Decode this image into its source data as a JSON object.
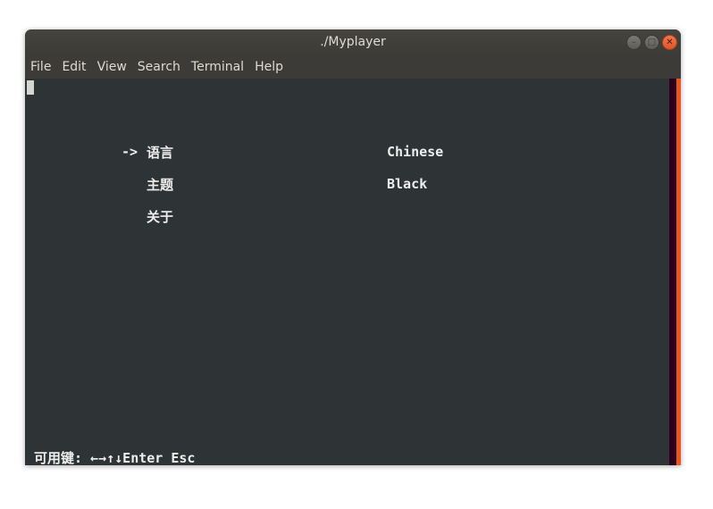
{
  "window": {
    "title": "./Myplayer",
    "controls": {
      "minimize": "–",
      "maximize": "□",
      "close": "✕"
    }
  },
  "menubar": {
    "items": [
      "File",
      "Edit",
      "View",
      "Search",
      "Terminal",
      "Help"
    ]
  },
  "terminal": {
    "selection_arrow": "->",
    "options": [
      {
        "label": "语言",
        "value": "Chinese"
      },
      {
        "label": "主题",
        "value": "Black"
      },
      {
        "label": "关于",
        "value": ""
      }
    ],
    "footer": "可用键: ←→↑↓Enter Esc"
  },
  "colors": {
    "terminal_bg": "#2e3436",
    "text": "#eeeeec",
    "titlebar": "#3c3b37",
    "accent": "#e95420"
  }
}
